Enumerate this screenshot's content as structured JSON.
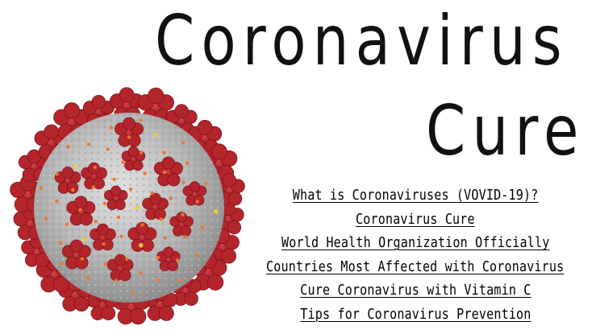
{
  "title": {
    "line1": "Coronavirus",
    "line2": "Cure"
  },
  "links": [
    "What is Coronaviruses (VOVID-19)?",
    "Coronavirus Cure",
    "World Health Organization Officially ",
    "Countries Most Affected with Coronavirus",
    "Cure Coronavirus with Vitamin C",
    "Tips for Coronavirus Prevention"
  ],
  "colors": {
    "spike": "#b3242b",
    "body": "#bcbcbc",
    "accent_orange": "#e8792f",
    "accent_yellow": "#f0c93a"
  },
  "image": {
    "icon": "coronavirus-illustration"
  }
}
